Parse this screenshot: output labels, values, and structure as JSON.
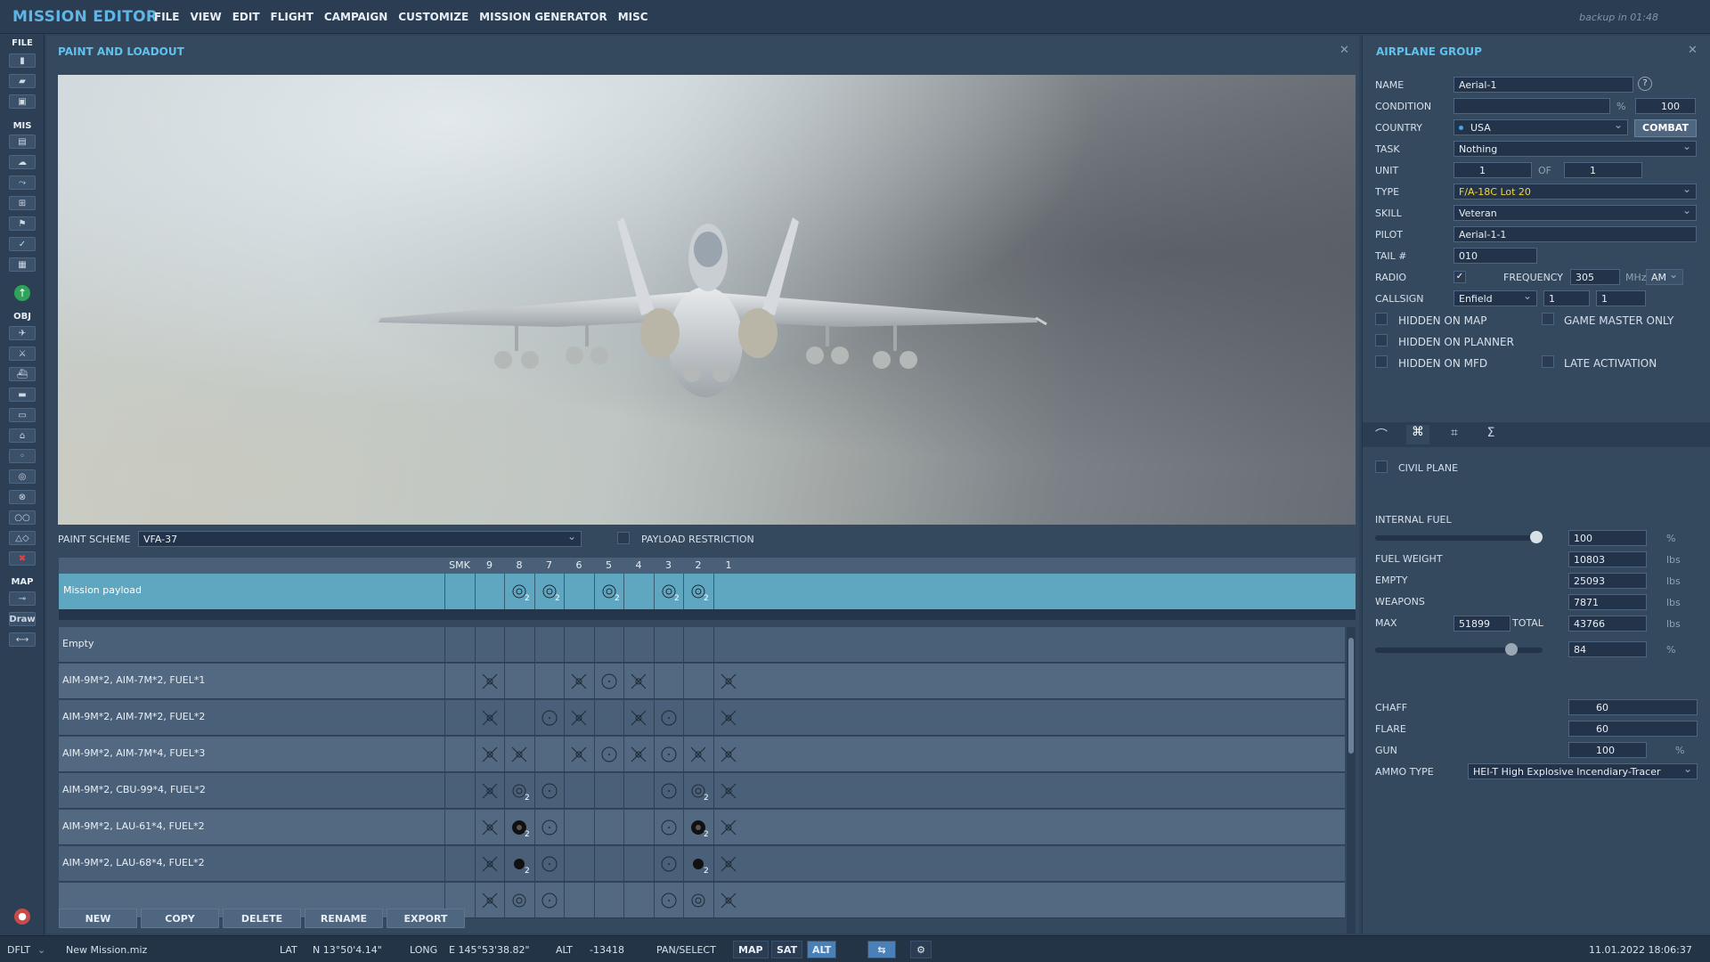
{
  "app": {
    "title": "MISSION EDITOR",
    "backup": "backup in 01:48"
  },
  "menu": [
    "FILE",
    "VIEW",
    "EDIT",
    "FLIGHT",
    "CAMPAIGN",
    "CUSTOMIZE",
    "MISSION GENERATOR",
    "MISC"
  ],
  "toolbar": {
    "file_label": "FILE",
    "mis_label": "MIS",
    "obj_label": "OBJ",
    "map_label": "MAP",
    "draw_label": "Draw"
  },
  "paint_panel": {
    "title": "PAINT AND LOADOUT",
    "paint_scheme_label": "PAINT SCHEME",
    "paint_scheme_value": "VFA-37",
    "payload_restriction_label": "PAYLOAD RESTRICTION",
    "pylon_headers": [
      "SMK",
      "9",
      "8",
      "7",
      "6",
      "5",
      "4",
      "3",
      "2",
      "1"
    ],
    "mission_payload": "Mission payload",
    "loadouts": [
      "Empty",
      "AIM-9M*2, AIM-7M*2, FUEL*1",
      "AIM-9M*2, AIM-7M*2, FUEL*2",
      "AIM-9M*2, AIM-7M*4, FUEL*3",
      "AIM-9M*2, CBU-99*4, FUEL*2",
      "AIM-9M*2, LAU-61*4, FUEL*2",
      "AIM-9M*2, LAU-68*4, FUEL*2"
    ],
    "buttons": [
      "NEW",
      "COPY",
      "DELETE",
      "RENAME",
      "EXPORT"
    ]
  },
  "group_panel": {
    "title": "AIRPLANE GROUP",
    "name_label": "NAME",
    "name_value": "Aerial-1",
    "condition_label": "CONDITION",
    "condition_unit": "%",
    "condition_value": "100",
    "country_label": "COUNTRY",
    "country_value": "USA",
    "combat_button": "COMBAT",
    "task_label": "TASK",
    "task_value": "Nothing",
    "unit_label": "UNIT",
    "unit_value": "1",
    "unit_of": "OF",
    "unit_total": "1",
    "type_label": "TYPE",
    "type_value": "F/A-18C Lot 20",
    "skill_label": "SKILL",
    "skill_value": "Veteran",
    "pilot_label": "PILOT",
    "pilot_value": "Aerial-1-1",
    "tail_label": "TAIL #",
    "tail_value": "010",
    "radio_label": "RADIO",
    "frequency_label": "FREQUENCY",
    "frequency_value": "305",
    "frequency_unit": "MHz",
    "modulation": "AM",
    "callsign_label": "CALLSIGN",
    "callsign_value": "Enfield",
    "callsign_n1": "1",
    "callsign_n2": "1",
    "hidden_on_map": "HIDDEN ON MAP",
    "game_master_only": "GAME MASTER ONLY",
    "hidden_on_planner": "HIDDEN ON PLANNER",
    "hidden_on_mfd": "HIDDEN ON MFD",
    "late_activation": "LATE ACTIVATION",
    "civil_plane": "CIVIL PLANE",
    "internal_fuel_label": "INTERNAL FUEL",
    "internal_fuel_value": "100",
    "internal_fuel_fraction": 1.0,
    "pct": "%",
    "fuel_weight_label": "FUEL WEIGHT",
    "fuel_weight_value": "10803",
    "empty_label": "EMPTY",
    "empty_value": "25093",
    "weapons_label": "WEAPONS",
    "weapons_value": "7871",
    "max_label": "MAX",
    "max_value": "51899",
    "total_label": "TOTAL",
    "total_value": "43766",
    "load_pct_value": "84",
    "load_fraction": 0.84,
    "lbs": "lbs",
    "chaff_label": "CHAFF",
    "chaff_value": "60",
    "flare_label": "FLARE",
    "flare_value": "60",
    "gun_label": "GUN",
    "gun_value": "100",
    "ammo_type_label": "AMMO TYPE",
    "ammo_type_value": "HEI-T High Explosive Incendiary-Tracer"
  },
  "status": {
    "profile": "DFLT",
    "mission_file": "New Mission.miz",
    "lat_label": "LAT",
    "lat_value": "N 13°50'4.14\"",
    "long_label": "LONG",
    "long_value": "E 145°53'38.82\"",
    "alt_label": "ALT",
    "alt_value": "-13418",
    "pan_select": "PAN/SELECT",
    "map_btn": "MAP",
    "sat_btn": "SAT",
    "alt_btn": "ALT",
    "datetime": "11.01.2022 18:06:37"
  }
}
